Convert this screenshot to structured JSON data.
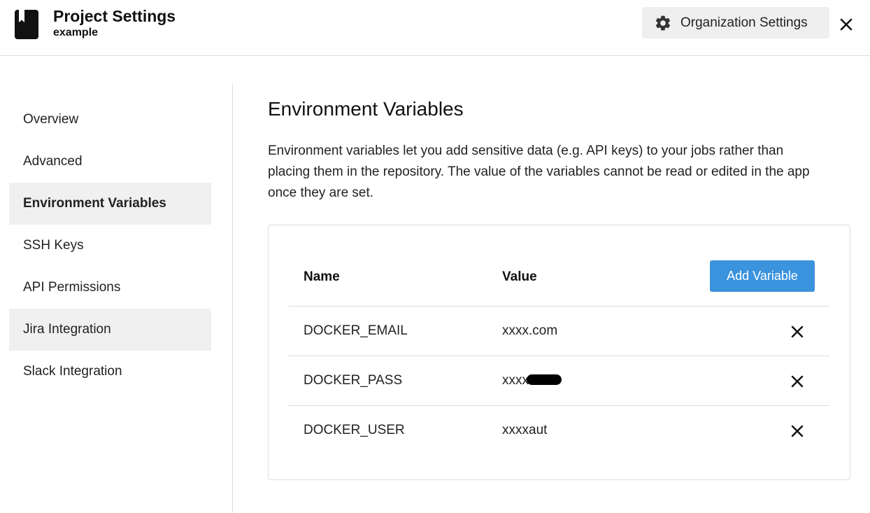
{
  "header": {
    "title": "Project Settings",
    "subtitle": "example",
    "org_button_label": "Organization Settings",
    "icons": {
      "project": "bookmark-icon",
      "org": "gear-icon",
      "close": "close-icon"
    }
  },
  "sidebar": {
    "items": [
      {
        "label": "Overview",
        "active": false
      },
      {
        "label": "Advanced",
        "active": false
      },
      {
        "label": "Environment Variables",
        "active": true
      },
      {
        "label": "SSH Keys",
        "active": false
      },
      {
        "label": "API Permissions",
        "active": false
      },
      {
        "label": "Jira Integration",
        "active": false,
        "hover": true
      },
      {
        "label": "Slack Integration",
        "active": false
      }
    ]
  },
  "main": {
    "title": "Environment Variables",
    "description": "Environment variables let you add sensitive data (e.g. API keys) to your jobs rather than placing them in the repository. The value of the variables cannot be read or edited in the app once they are set.",
    "table": {
      "headers": {
        "name": "Name",
        "value": "Value"
      },
      "add_button_label": "Add Variable",
      "rows": [
        {
          "name": "DOCKER_EMAIL",
          "value": "xxxx.com"
        },
        {
          "name": "DOCKER_PASS",
          "value": "xxxx"
        },
        {
          "name": "DOCKER_USER",
          "value": "xxxxaut"
        }
      ]
    }
  },
  "colors": {
    "accent": "#3b92dd",
    "active_bg": "#f0f0f0",
    "border": "#dcdcdc"
  }
}
